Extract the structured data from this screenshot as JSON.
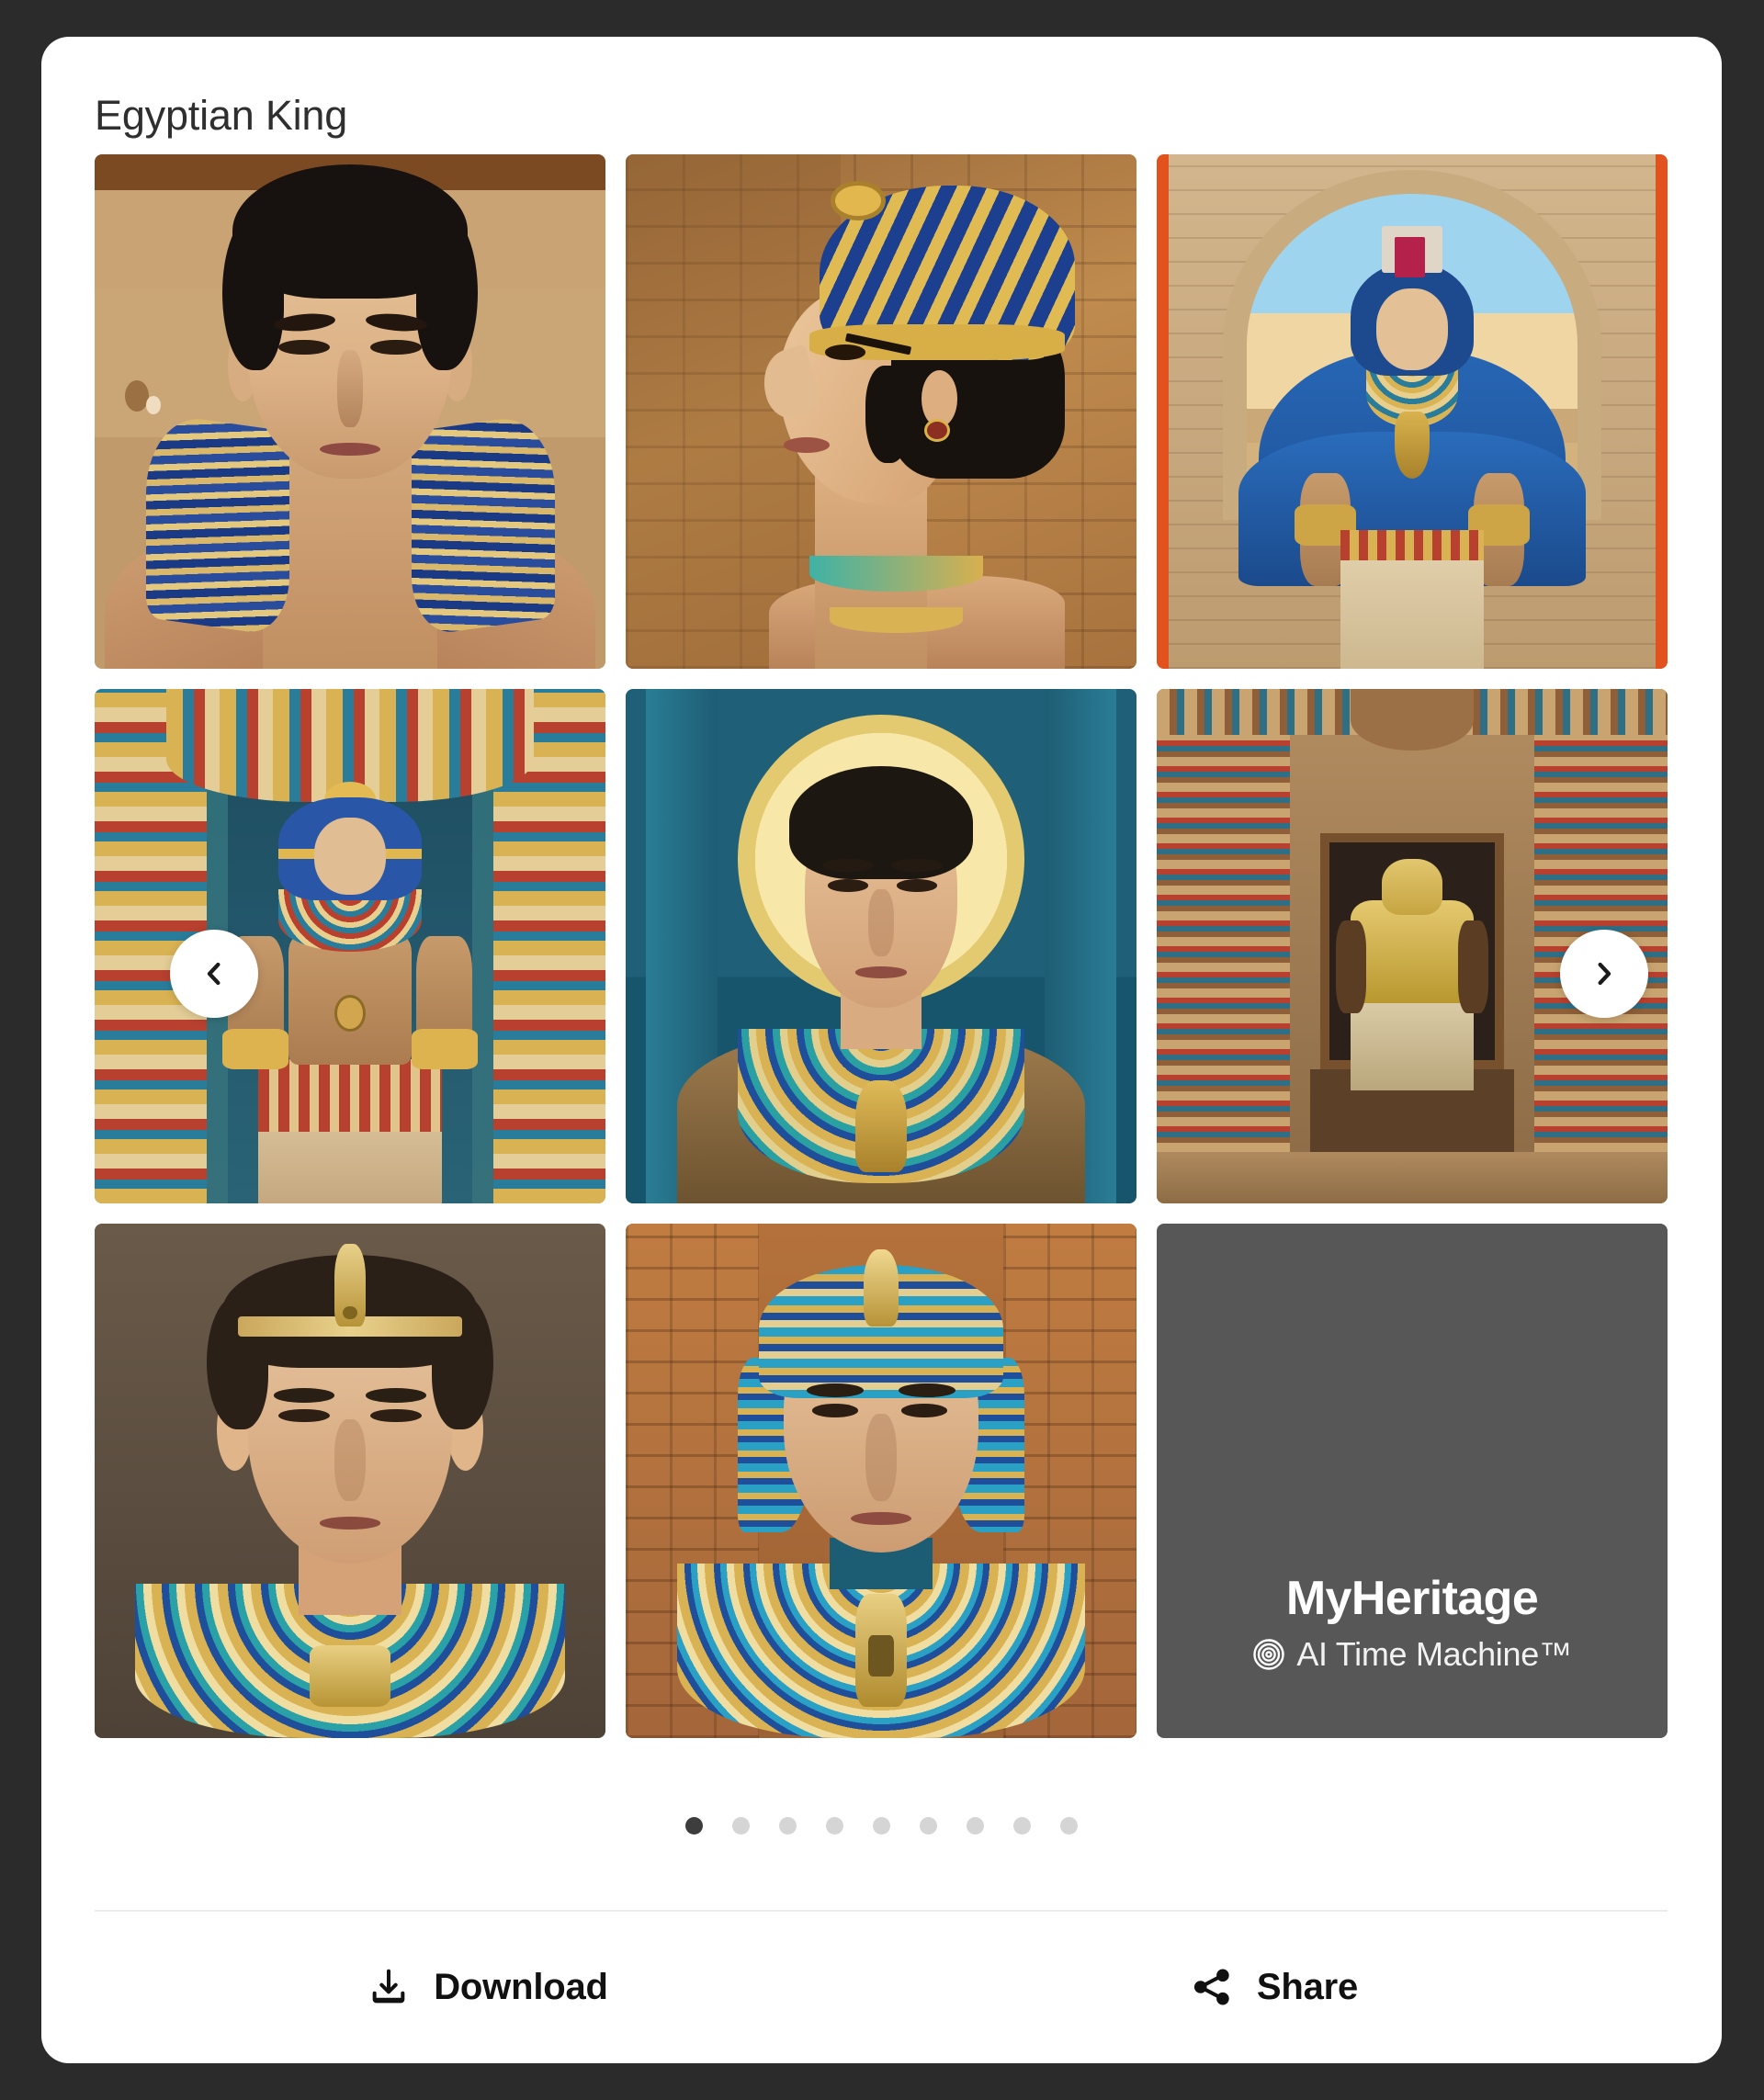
{
  "app": {
    "background_color": "#2b2b2b",
    "card_background": "#ffffff"
  },
  "card": {
    "title": "Egyptian King"
  },
  "gallery": {
    "tiles": [
      {
        "id": 1,
        "alt": "Egyptian king frontal portrait with striped blue and gold collar against sandstone wall"
      },
      {
        "id": 2,
        "alt": "Egyptian king profile portrait wearing blue and gold khepresh crown before hieroglyph wall"
      },
      {
        "id": 3,
        "alt": "Egyptian king enthroned in blue cloak beneath a stone arch"
      },
      {
        "id": 4,
        "alt": "Egyptian king seated on golden throne in ornate painted temple"
      },
      {
        "id": 5,
        "alt": "Egyptian king portrait with golden halo on teal background"
      },
      {
        "id": 6,
        "alt": "Golden pharaoh statue standing in a columned temple hall"
      },
      {
        "id": 7,
        "alt": "Close-up Egyptian king with uraeus headband and beaded collar"
      },
      {
        "id": 8,
        "alt": "Egyptian king frontal portrait with striped nemes headdress and hieroglyph wall"
      }
    ],
    "brand_tile": {
      "name": "MyHeritage",
      "product": "AI Time Machine™",
      "icon": "spiral-target-icon",
      "background_color": "#575757"
    },
    "prev_arrow": {
      "icon": "chevron-left-icon"
    },
    "next_arrow": {
      "icon": "chevron-right-icon"
    }
  },
  "pagination": {
    "total": 9,
    "active_index": 0,
    "active_color": "#3d3d3d",
    "inactive_color": "#d5d5d5"
  },
  "actions": {
    "download": {
      "label": "Download",
      "icon": "download-icon"
    },
    "share": {
      "label": "Share",
      "icon": "share-nodes-icon"
    }
  }
}
